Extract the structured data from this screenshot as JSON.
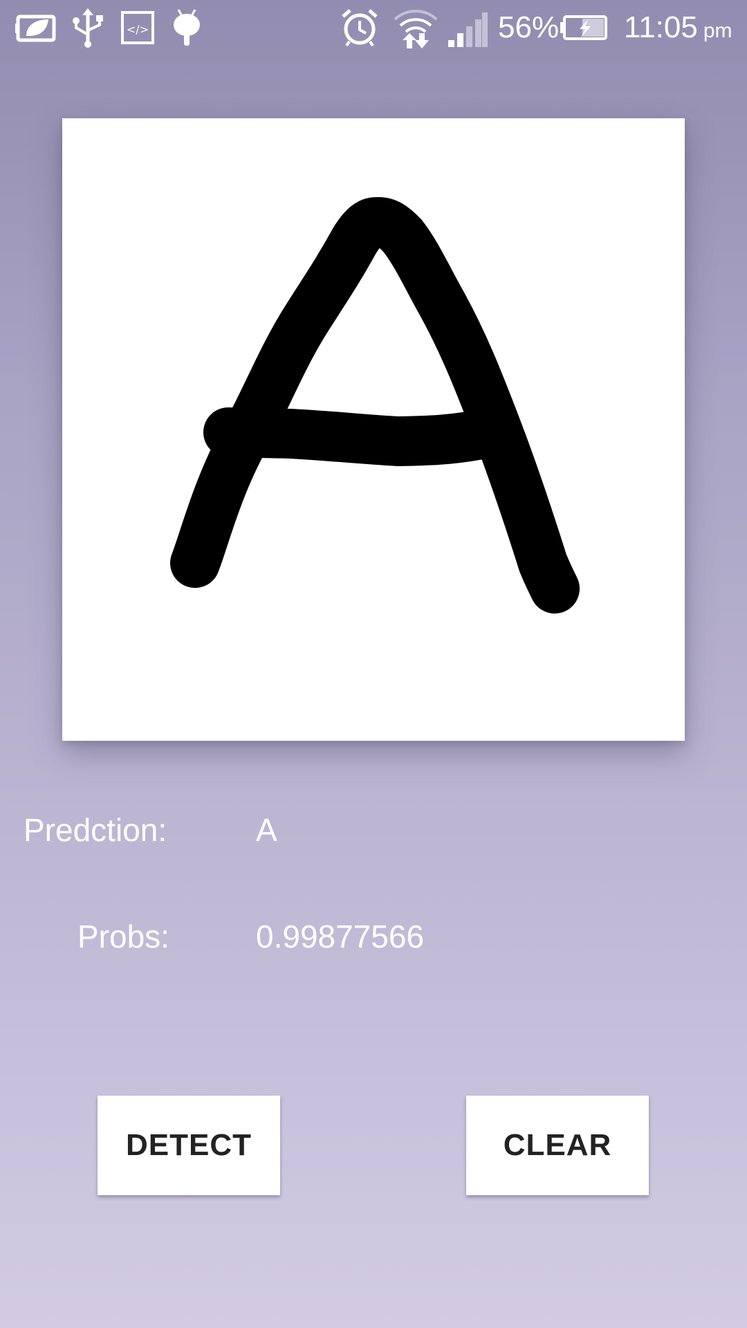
{
  "status_bar": {
    "icons_left": [
      "battery-saver-icon",
      "usb-icon",
      "developer-mode-icon",
      "android-debug-icon"
    ],
    "icons_right": [
      "alarm-icon",
      "wifi-icon",
      "signal-icon",
      "battery-charging-icon"
    ],
    "battery_percent": "56%",
    "time": "11:05",
    "ampm": "pm"
  },
  "canvas": {
    "drawn_character": "A",
    "stroke_color": "#000000",
    "background_color": "#ffffff"
  },
  "result": {
    "prediction_label": "Predction:",
    "prediction_value": "A",
    "probs_label": "Probs:",
    "probs_value": "0.99877566"
  },
  "buttons": {
    "detect_label": "DETECT",
    "clear_label": "CLEAR"
  },
  "colors": {
    "background_top": "#928db0",
    "background_bottom": "#d2cbe3",
    "text": "#ffffff",
    "button_bg": "#ffffff",
    "button_text": "#222222"
  }
}
